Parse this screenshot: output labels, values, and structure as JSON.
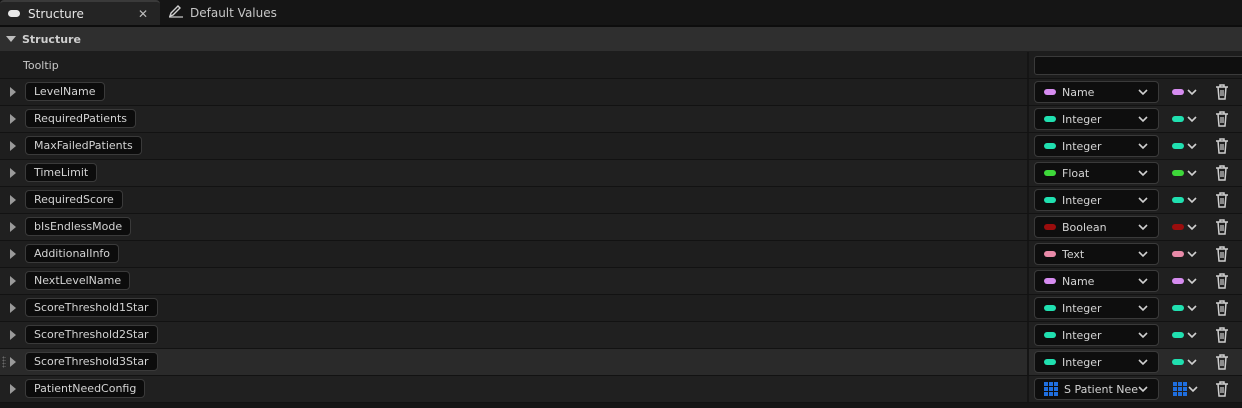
{
  "tabs": [
    {
      "label": "Structure",
      "icon": "struct-pill-icon",
      "active": true
    },
    {
      "label": "Default Values",
      "icon": "pencil-icon",
      "active": false
    }
  ],
  "section": {
    "title": "Structure"
  },
  "tooltip": {
    "label": "Tooltip",
    "value": ""
  },
  "colors": {
    "Name": "#d68cf0",
    "Integer": "#20e0b0",
    "Float": "#3ed83a",
    "Boolean": "#9a0d0d",
    "Text": "#e88aa8",
    "Struct": "#1f6fe0"
  },
  "members": [
    {
      "name": "LevelName",
      "type": "Name",
      "color": "#d68cf0"
    },
    {
      "name": "RequiredPatients",
      "type": "Integer",
      "color": "#20e0b0"
    },
    {
      "name": "MaxFailedPatients",
      "type": "Integer",
      "color": "#20e0b0"
    },
    {
      "name": "TimeLimit",
      "type": "Float",
      "color": "#3ed83a"
    },
    {
      "name": "RequiredScore",
      "type": "Integer",
      "color": "#20e0b0"
    },
    {
      "name": "bIsEndlessMode",
      "type": "Boolean",
      "color": "#9a0d0d"
    },
    {
      "name": "AdditionalInfo",
      "type": "Text",
      "color": "#e88aa8"
    },
    {
      "name": "NextLevelName",
      "type": "Name",
      "color": "#d68cf0"
    },
    {
      "name": "ScoreThreshold1Star",
      "type": "Integer",
      "color": "#20e0b0"
    },
    {
      "name": "ScoreThreshold2Star",
      "type": "Integer",
      "color": "#20e0b0"
    },
    {
      "name": "ScoreThreshold3Star",
      "type": "Integer",
      "color": "#20e0b0"
    },
    {
      "name": "PatientNeedConfig",
      "type": "S Patient Nee",
      "color": "#1f6fe0",
      "struct": true
    }
  ]
}
